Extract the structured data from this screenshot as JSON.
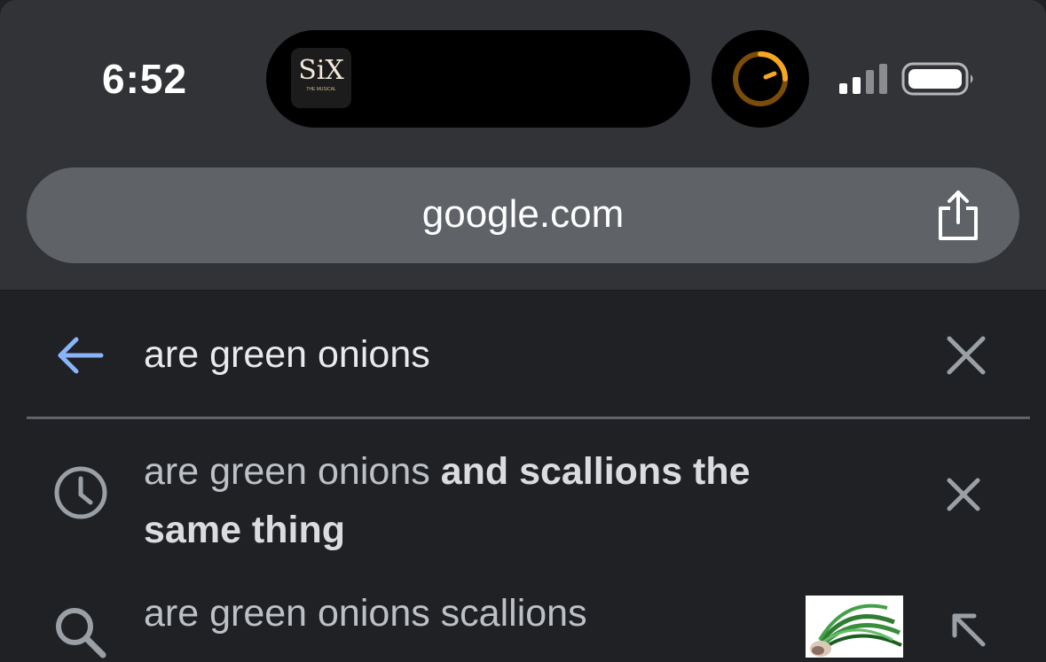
{
  "status_bar": {
    "time": "6:52",
    "now_playing": {
      "title": "SiX",
      "subtitle": "THE MUSICAL"
    }
  },
  "browser": {
    "url": "google.com",
    "icons": {
      "share": "share-icon"
    }
  },
  "search": {
    "query": "are green onions",
    "icons": {
      "back": "back-arrow-icon",
      "clear": "close-icon"
    }
  },
  "suggestions": [
    {
      "type": "history",
      "icon": "clock-icon",
      "prefix": "are green onions",
      "completion_line1": "and scallions the",
      "completion_line2": "same thing",
      "action_icon": "close-icon"
    },
    {
      "type": "search",
      "icon": "search-icon",
      "text": "are green onions scallions",
      "thumbnail": "green-onions-image",
      "action_icon": "arrow-up-left-icon"
    }
  ],
  "colors": {
    "background": "#202124",
    "toolbar": "#313336",
    "urlbar": "#5f6368",
    "accent_blue": "#8ab4f8",
    "timer_orange": "#f5a623"
  }
}
